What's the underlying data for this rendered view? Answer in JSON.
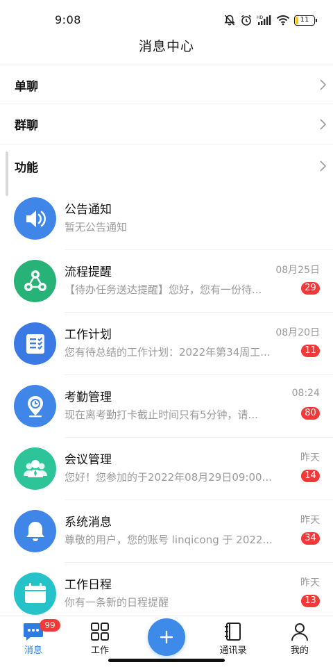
{
  "status_bar": {
    "time": "9:08",
    "battery": "11"
  },
  "header": {
    "title": "消息中心"
  },
  "sections": [
    {
      "label": "单聊"
    },
    {
      "label": "群聊"
    },
    {
      "label": "功能"
    }
  ],
  "messages": [
    {
      "title": "公告通知",
      "preview": "暂无公告通知",
      "time": "",
      "badge": "",
      "icon": "speaker-icon",
      "color": "#3f86e8"
    },
    {
      "title": "流程提醒",
      "preview": "【待办任务送达提醒】您好，您有一份待...",
      "time": "08月25日",
      "badge": "29",
      "icon": "share-flow-icon",
      "color": "#27b277"
    },
    {
      "title": "工作计划",
      "preview": "您有待总结的工作计划：2022年第34周工...",
      "time": "08月20日",
      "badge": "11",
      "icon": "checklist-icon",
      "color": "#3b79e4"
    },
    {
      "title": "考勤管理",
      "preview": "现在离考勤打卡截止时间只有5分钟，请...",
      "time": "08:24",
      "badge": "80",
      "icon": "location-clock-icon",
      "color": "#3f86e8"
    },
    {
      "title": "会议管理",
      "preview": "您好！您参加的于2022年08月29日09:00...",
      "time": "昨天",
      "badge": "14",
      "icon": "people-icon",
      "color": "#2ec49a"
    },
    {
      "title": "系统消息",
      "preview": "尊敬的用户，您的账号 linqicong 于 2022...",
      "time": "昨天",
      "badge": "34",
      "icon": "bell-icon",
      "color": "#3f86e8"
    },
    {
      "title": "工作日程",
      "preview": "你有一条新的日程提醒",
      "time": "昨天",
      "badge": "13",
      "icon": "calendar-icon",
      "color": "#25c2c9"
    }
  ],
  "bottom_nav": {
    "items": [
      {
        "label": "消息",
        "icon": "chat-icon",
        "badge": "99"
      },
      {
        "label": "工作",
        "icon": "grid-icon"
      },
      {
        "label": "通讯录",
        "icon": "contacts-book-icon"
      },
      {
        "label": "我的",
        "icon": "person-icon"
      }
    ],
    "fab_icon": "plus-icon"
  },
  "colors": {
    "accent": "#3d8ae8",
    "badge": "#f03a3a",
    "muted": "#9a9a9a"
  }
}
